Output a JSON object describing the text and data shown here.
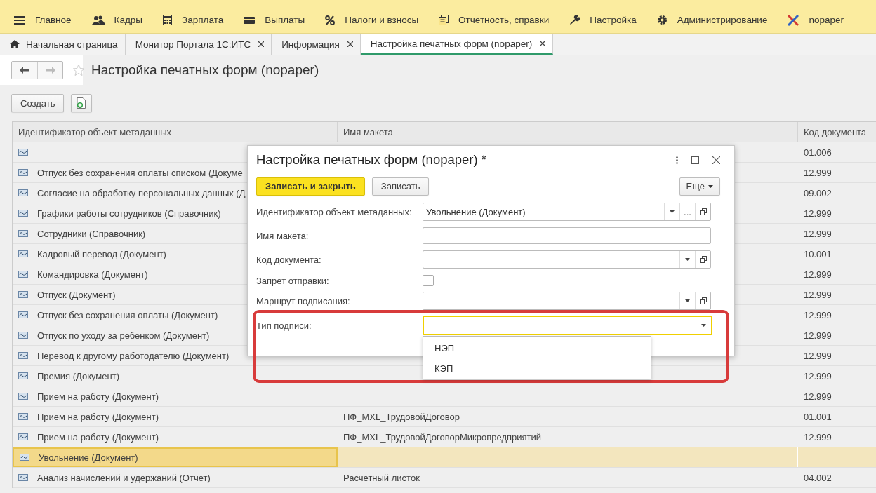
{
  "menu": [
    {
      "label": "Главное"
    },
    {
      "label": "Кадры"
    },
    {
      "label": "Зарплата"
    },
    {
      "label": "Выплаты"
    },
    {
      "label": "Налоги и взносы"
    },
    {
      "label": "Отчетность, справки"
    },
    {
      "label": "Настройка"
    },
    {
      "label": "Администрирование"
    },
    {
      "label": "nopaper"
    }
  ],
  "tabs": [
    {
      "label": "Начальная страница",
      "selected": false,
      "closable": false
    },
    {
      "label": "Монитор Портала 1С:ИТС",
      "selected": false,
      "closable": true
    },
    {
      "label": "Информация",
      "selected": false,
      "closable": true
    },
    {
      "label": "Настройка печатных форм (nopaper)",
      "selected": true,
      "closable": true
    }
  ],
  "page_title": "Настройка печатных форм (nopaper)",
  "toolbar": {
    "create_button": "Создать"
  },
  "table": {
    "columns": [
      "Идентификатор объект метаданных",
      "Имя макета",
      "Код документа"
    ],
    "rows": [
      {
        "cells": [
          "",
          "",
          "01.006"
        ],
        "selected": false
      },
      {
        "cells": [
          "Отпуск без сохранения оплаты списком (Докуме",
          "",
          "12.999"
        ],
        "selected": false
      },
      {
        "cells": [
          "Согласие на обработку персональных данных (Д",
          "",
          "09.002"
        ],
        "selected": false
      },
      {
        "cells": [
          "Графики работы сотрудников (Справочник)",
          "",
          "12.999"
        ],
        "selected": false
      },
      {
        "cells": [
          "Сотрудники (Справочник)",
          "",
          "12.999"
        ],
        "selected": false
      },
      {
        "cells": [
          "Кадровый перевод (Документ)",
          "",
          "10.001"
        ],
        "selected": false
      },
      {
        "cells": [
          "Командировка (Документ)",
          "",
          "12.999"
        ],
        "selected": false
      },
      {
        "cells": [
          "Отпуск (Документ)",
          "",
          "12.999"
        ],
        "selected": false
      },
      {
        "cells": [
          "Отпуск без сохранения оплаты (Документ)",
          "",
          "12.999"
        ],
        "selected": false
      },
      {
        "cells": [
          "Отпуск по уходу за ребенком (Документ)",
          "",
          "12.999"
        ],
        "selected": false
      },
      {
        "cells": [
          "Перевод к другому работодателю (Документ)",
          "",
          "12.999"
        ],
        "selected": false
      },
      {
        "cells": [
          "Премия (Документ)",
          "",
          "12.999"
        ],
        "selected": false
      },
      {
        "cells": [
          "Прием на работу (Документ)",
          "",
          "12.999"
        ],
        "selected": false
      },
      {
        "cells": [
          "Прием на работу (Документ)",
          "ПФ_MXL_ТрудовойДоговор",
          "01.001"
        ],
        "selected": false
      },
      {
        "cells": [
          "Прием на работу (Документ)",
          "ПФ_MXL_ТрудовойДоговорМикропредприятий",
          "12.999"
        ],
        "selected": false
      },
      {
        "cells": [
          "Увольнение (Документ)",
          "",
          ""
        ],
        "selected": true
      },
      {
        "cells": [
          "Анализ начислений и удержаний (Отчет)",
          "Расчетный листок",
          "04.002"
        ],
        "selected": false
      }
    ]
  },
  "dialog": {
    "title": "Настройка печатных форм (nopaper) *",
    "save_close_button": "Записать и закрыть",
    "save_button": "Записать",
    "more_button": "Еще",
    "fields": [
      {
        "kind": "combo",
        "label": "Идентификатор объект метаданных:",
        "value": "Увольнение (Документ)",
        "choice_button": "...",
        "focused": false
      },
      {
        "kind": "text",
        "label": "Имя макета:",
        "focused": false
      },
      {
        "kind": "combo",
        "label": "Код документа:",
        "focused": false
      },
      {
        "kind": "checkbox",
        "label": "Запрет отправки:",
        "checked": false
      },
      {
        "kind": "combo",
        "label": "Маршрут подписания:",
        "focused": false
      },
      {
        "kind": "select",
        "label": "Тип подписи:",
        "focused": true
      }
    ],
    "dropdown_options": [
      "НЭП",
      "КЭП"
    ]
  }
}
